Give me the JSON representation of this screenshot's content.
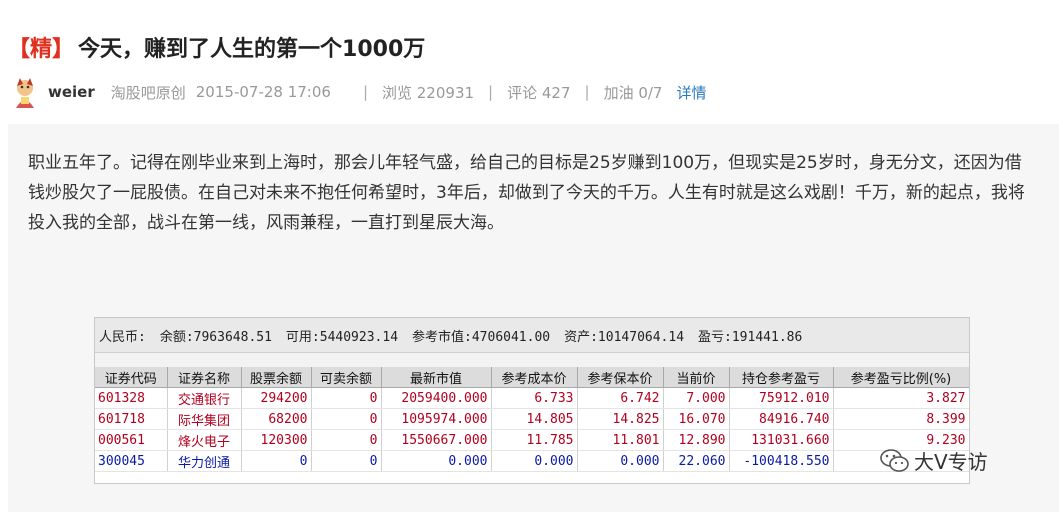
{
  "post": {
    "tag": "【精】",
    "title": "今天，赚到了人生的第一个1000万",
    "author": "weier",
    "source": "淘股吧原创",
    "time": "2015-07-28 17:06",
    "views": "浏览 220931",
    "comments": "评论 427",
    "cheer": "加油 0/7",
    "detail_link": "详情",
    "separator": "|",
    "body": "职业五年了。记得在刚毕业来到上海时，那会儿年轻气盛，给自己的目标是25岁赚到100万，但现实是25岁时，身无分文，还因为借钱炒股欠了一屁股债。在自己对未来不抱任何希望时，3年后，却做到了今天的千万。人生有时就是这么戏剧！千万，新的起点，我将投入我的全部，战斗在第一线，风雨兼程，一直打到星辰大海。"
  },
  "account": {
    "currency": "人民币:",
    "balance": "余额:7963648.51",
    "available": "可用:5440923.14",
    "market_value": "参考市值:4706041.00",
    "assets": "资产:10147064.14",
    "profit": "盈亏:191441.86"
  },
  "table": {
    "headers": [
      "证券代码",
      "证券名称",
      "股票余额",
      "可卖余额",
      "最新市值",
      "参考成本价",
      "参考保本价",
      "当前价",
      "持仓参考盈亏",
      "参考盈亏比例(%)"
    ],
    "rows": [
      [
        "601328",
        "交通银行",
        "294200",
        "0",
        "2059400.000",
        "6.733",
        "6.742",
        "7.000",
        "75912.010",
        "3.827"
      ],
      [
        "601718",
        "际华集团",
        "68200",
        "0",
        "1095974.000",
        "14.805",
        "14.825",
        "16.070",
        "84916.740",
        "8.399"
      ],
      [
        "000561",
        "烽火电子",
        "120300",
        "0",
        "1550667.000",
        "11.785",
        "11.801",
        "12.890",
        "131031.660",
        "9.230"
      ],
      [
        "300045",
        "华力创通",
        "0",
        "0",
        "0.000",
        "0.000",
        "0.000",
        "22.060",
        "-100418.550",
        ""
      ]
    ]
  },
  "watermark": "大V专访",
  "colors": {
    "tag_red": "#e0301e",
    "link_blue": "#2a7ac0",
    "row_red": "#b3001e",
    "row_blue": "#0a1aa6"
  }
}
